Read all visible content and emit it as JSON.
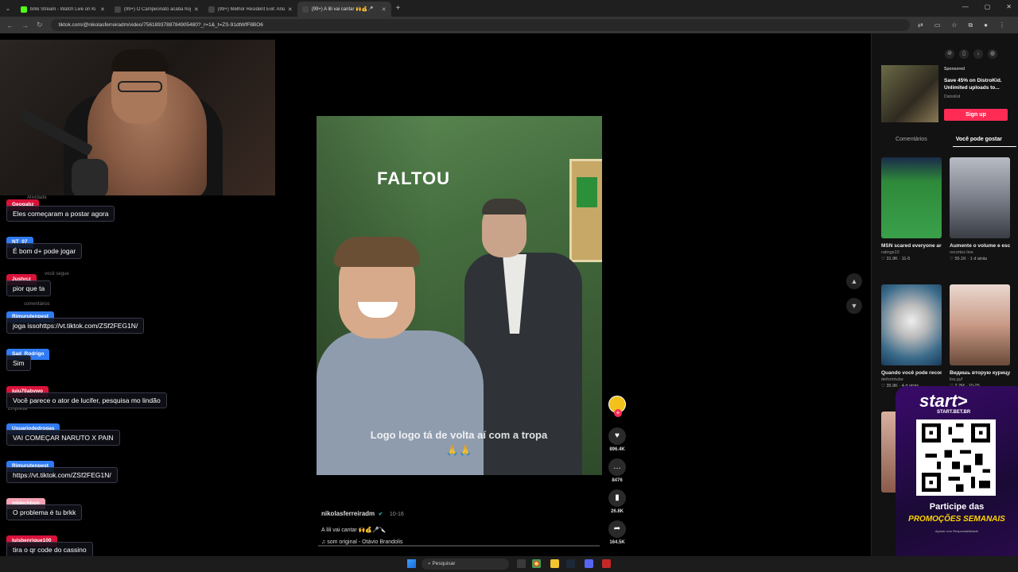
{
  "browser": {
    "tabs": [
      {
        "title": "brkk Stream - Watch Live on Ki",
        "active": false
      },
      {
        "title": "(99+) O Campeonato acaba hoj",
        "active": false
      },
      {
        "title": "(99+) Melhor Resident Evil: Anú",
        "active": false
      },
      {
        "title": "(99+) A lili vai cantar 🙌💰🎤",
        "active": true
      }
    ],
    "url": "tiktok.com/@nikolasferreiradm/video/7561893788784905480?_r=1&_t=ZS-91dtWfF8BO6"
  },
  "chat": {
    "messages": [
      {
        "user": "Geogabz",
        "text": "Eles começaram a postar agora",
        "color": "#d9123a"
      },
      {
        "user": "NT_07",
        "text": "É bom d+ pode jogar",
        "color": "#2f7bf5"
      },
      {
        "user": "Justycz",
        "text": "pior que ta",
        "color": "#d9123a"
      },
      {
        "user": "Rimurutenpest",
        "text": "joga issohttps://vt.tiktok.com/ZSf2FEG1N/",
        "color": "#2f7bf5"
      },
      {
        "user": "Sad_Rodrigo",
        "text": "Sim",
        "color": "#2f7bf5"
      },
      {
        "user": "juju70abvwo",
        "text": "Você parece o ator de lucifer, pesquisa mo lindão",
        "color": "#d9123a"
      },
      {
        "user": "Usuariodedrogas",
        "text": "VAI COMEÇAR NARUTO X PAIN",
        "color": "#2f7bf5"
      },
      {
        "user": "Rimurutenpest",
        "text": "https://vt.tiktok.com/ZSf2FEG1N/",
        "color": "#2f7bf5"
      },
      {
        "user": "mblechbon",
        "text": "O problema é tu brkk",
        "color": "#f5a3b4"
      },
      {
        "user": "luisbenrique100",
        "text": "tira o qr code do cassino",
        "color": "#d9123a"
      }
    ],
    "ghost": [
      "Atividade",
      "você segue",
      "comentários",
      "Empresa"
    ]
  },
  "video": {
    "overlay_title": "FALTOU",
    "caption": "Logo logo tá de volta aí com a tropa 🙏🙏",
    "author": "nikolasferreiradm",
    "date": "10-16",
    "description": "A lili vai cantar 🙌💰🎤🔪",
    "sound": "som original - Otávio Brandolis",
    "likes": "896.4K",
    "comments": "8476",
    "saves": "26.8K",
    "shares": "164.5K"
  },
  "sidebar": {
    "ad": {
      "sponsored": "Sponsored",
      "title": "Save 45% on DistroKid. Unlimited uploads to...",
      "brand": "DistroKid",
      "cta": "Sign up"
    },
    "tabs": [
      "Comentários",
      "Você pode gostar"
    ],
    "cards": [
      {
        "title": "MSN scared everyone around...",
        "author": "ratings10",
        "likes": "31.9K",
        "date": "11-5"
      },
      {
        "title": "Aumente o volume e escuta oq kosk...",
        "author": "recortez.live",
        "likes": "55.1K",
        "date": "1 d atrás"
      },
      {
        "title": "Quando você pode reconhecê-lo?...",
        "author": "deformtube",
        "likes": "35.9K",
        "date": "4 d atrás"
      },
      {
        "title": "Видишь вторую курицу?😂😂",
        "author": "lira.pyf",
        "likes": "2.2M",
        "date": "10-25"
      }
    ]
  },
  "promo": {
    "logo": "start>",
    "site": "START.BET.BR",
    "line1": "Participe das",
    "line2": "PROMOÇÕES SEMANAIS",
    "legal": "Aposte com Responsabilidade"
  },
  "taskbar": {
    "search": "Pesquisar"
  }
}
